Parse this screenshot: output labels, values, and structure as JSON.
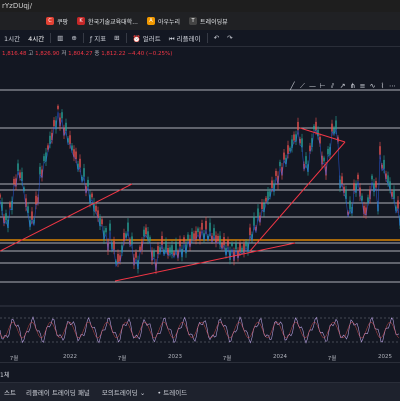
{
  "browser": {
    "url": "rYzDUqj/",
    "bookmarks": [
      {
        "label": "쿠팡",
        "icon": "coupang-icon",
        "color": "#e34234"
      },
      {
        "label": "한국기술교육대학...",
        "icon": "university-icon",
        "color": "#c62828"
      },
      {
        "label": "아우누리",
        "icon": "aunuri-icon",
        "color": "#f29900"
      },
      {
        "label": "트레이딩뷰",
        "icon": "tradingview-icon",
        "color": "#444444"
      }
    ]
  },
  "toolbar": {
    "timeframes": [
      "1시간",
      "4시간"
    ],
    "indicators": "지표",
    "alert": "얼러트",
    "replay": "리플레이"
  },
  "ohlc": {
    "prefix": "1,816.48",
    "high_label": "고",
    "high": "1,826.90",
    "low_label": "저",
    "low": "1,804.27",
    "close_label": "종",
    "close": "1,812.22",
    "change": "−4.40 (−0.25%)"
  },
  "chart_data": {
    "type": "candlestick",
    "x_ticks": [
      "7월",
      "2022",
      "7월",
      "2023",
      "7월",
      "2024",
      "7월",
      "2025"
    ],
    "horizontal_levels": "multiple white support/resistance lines, orange level",
    "trendlines": "red trendlines",
    "lower_pane": "oscillator with purple line"
  },
  "statusbar": {
    "zoom": "1체"
  },
  "bottom_tabs": {
    "items": [
      "스트",
      "리플레이 트레이딩 패널",
      "모의트레이딩",
      "트레이드"
    ]
  }
}
